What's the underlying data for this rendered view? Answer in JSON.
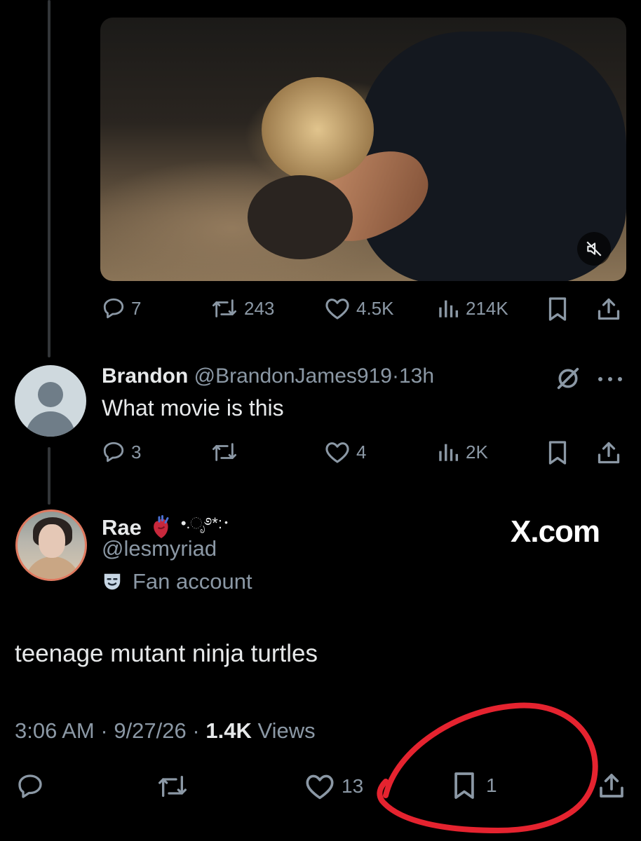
{
  "tweet1": {
    "replies": "7",
    "reposts": "243",
    "likes": "4.5K",
    "views": "214K"
  },
  "tweet2": {
    "name": "Brandon",
    "handle": "@BrandonJames919",
    "separator": "·",
    "time": "13h",
    "text": "What movie is this",
    "replies": "3",
    "likes": "4",
    "views": "2K"
  },
  "tweet3": {
    "name": "Rae",
    "name_decor": "•.ೃ࿔*:･",
    "handle": "@lesmyriad",
    "label": "Fan account",
    "text": "teenage mutant ninja turtles",
    "time": "3:06 AM",
    "date": "9/27/26",
    "views_count": "1.4K",
    "views_label": "Views",
    "sep": "·",
    "likes": "13",
    "bookmarks": "1"
  },
  "watermark": "X.com",
  "colors": {
    "background": "#000000",
    "text": "#e7e9ea",
    "muted": "#8b98a5",
    "annotation": "#e5232f"
  }
}
